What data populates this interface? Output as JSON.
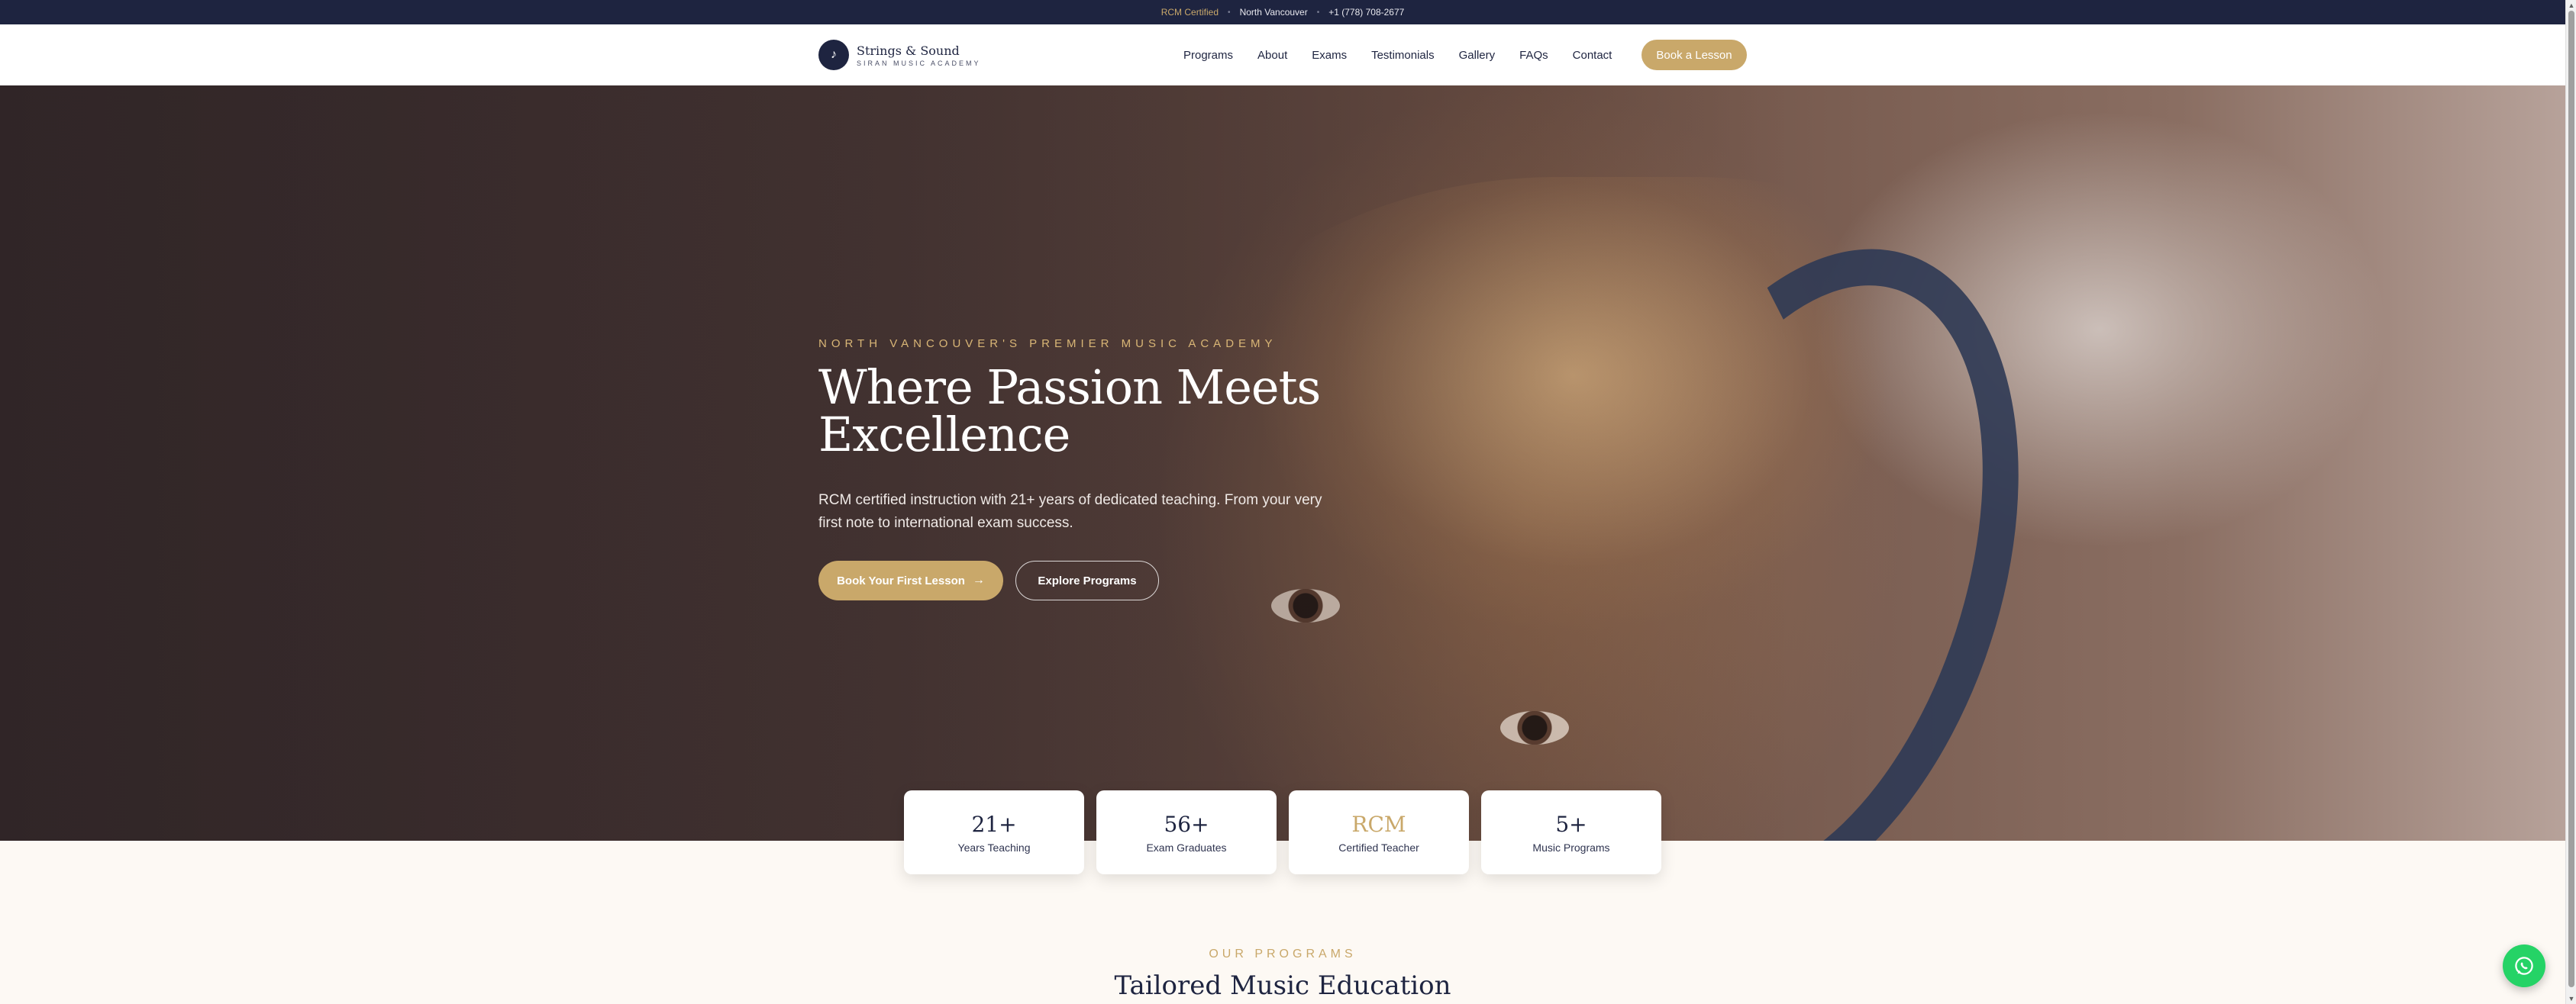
{
  "topbar": {
    "certified": "RCM Certified",
    "location": "North Vancouver",
    "phone": "+1 (778) 708-2677",
    "separator": "•"
  },
  "brand": {
    "name": "Strings & Sound",
    "subtitle": "SIRAN MUSIC ACADEMY",
    "logo_glyph": "♪"
  },
  "nav": {
    "items": [
      "Programs",
      "About",
      "Exams",
      "Testimonials",
      "Gallery",
      "FAQs",
      "Contact"
    ],
    "cta": "Book a Lesson"
  },
  "hero": {
    "eyebrow": "NORTH VANCOUVER'S PREMIER MUSIC ACADEMY",
    "title_line1": "Where Passion Meets",
    "title_line2": "Excellence",
    "description": "RCM certified instruction with 21+ years of dedicated teaching. From your very first note to international exam success.",
    "primary_button": "Book Your First Lesson",
    "primary_arrow": "→",
    "secondary_button": "Explore Programs"
  },
  "stats": [
    {
      "value": "21+",
      "label": "Years Teaching"
    },
    {
      "value": "56+",
      "label": "Exam Graduates"
    },
    {
      "value": "RCM",
      "label": "Certified Teacher"
    },
    {
      "value": "5+",
      "label": "Music Programs"
    }
  ],
  "programs": {
    "eyebrow": "OUR PROGRAMS",
    "title": "Tailored Music Education"
  },
  "colors": {
    "navy": "#1e2440",
    "gold": "#c9a86a",
    "whatsapp": "#25d366"
  },
  "icons": {
    "whatsapp": "whatsapp-icon",
    "logo": "music-note-icon"
  }
}
